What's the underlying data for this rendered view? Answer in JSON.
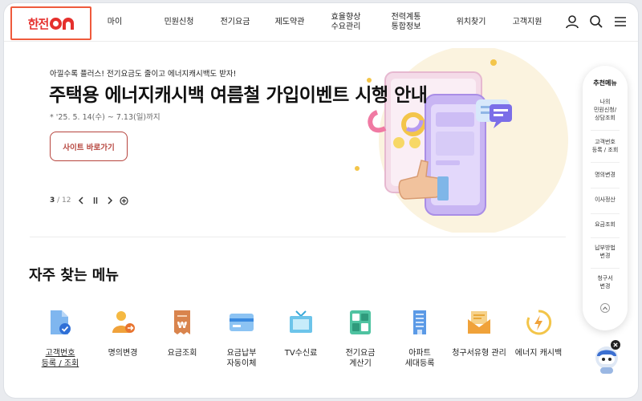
{
  "header": {
    "logo_text": "한전",
    "nav": [
      {
        "label": "마이"
      },
      {
        "label": "민원신청"
      },
      {
        "label": "전기요금"
      },
      {
        "label": "제도약관"
      },
      {
        "label": "효율향상\n수요관리"
      },
      {
        "label": "전력계통\n통합정보"
      },
      {
        "label": "위치찾기"
      },
      {
        "label": "고객지원"
      }
    ],
    "icons": [
      "user-icon",
      "search-icon",
      "menu-icon"
    ]
  },
  "hero": {
    "subtitle": "아낄수록 플러스! 전기요금도 줄이고 에너지캐시백도 받자!",
    "title": "주택용 에너지캐시백 여름철 가입이벤트 시행 안내",
    "date": "* '25. 5. 14(수) ~ 7.13(일)까지",
    "button_label": "사이트 바로가기",
    "pager": {
      "current": "3",
      "total": "/ 12"
    }
  },
  "frequent": {
    "title": "자주 찾는 메뉴",
    "items": [
      {
        "label": "고객번호\n등록 / 조회",
        "icon": "document-check-icon",
        "underline": true
      },
      {
        "label": "명의변경",
        "icon": "person-change-icon"
      },
      {
        "label": "요금조회",
        "icon": "receipt-won-icon"
      },
      {
        "label": "요금납부\n자동이체",
        "icon": "card-icon"
      },
      {
        "label": "TV수신료",
        "icon": "tv-icon"
      },
      {
        "label": "전기요금\n계산기",
        "icon": "calculator-icon"
      },
      {
        "label": "아파트\n세대등록",
        "icon": "apartment-icon"
      },
      {
        "label": "청구서유형 관리",
        "icon": "envelope-icon"
      },
      {
        "label": "에너지 캐시백",
        "icon": "energy-cashback-icon"
      }
    ]
  },
  "quick": {
    "title": "추천메뉴",
    "items": [
      {
        "label": "나의\n민원신청/\n상담조회"
      },
      {
        "label": "고객번호\n등록 / 조회"
      },
      {
        "label": "명의변경"
      },
      {
        "label": "이사정산"
      },
      {
        "label": "요금조회"
      },
      {
        "label": "납부방법\n변경"
      },
      {
        "label": "청구서\n변경"
      }
    ]
  },
  "colors": {
    "brand": "#e5302d",
    "button_border": "#b6443d",
    "logo_highlight": "#ef5a3c"
  }
}
